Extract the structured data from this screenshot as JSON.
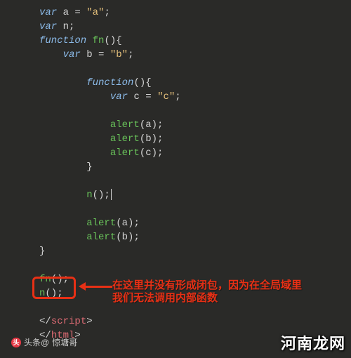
{
  "code": {
    "l1a": "var",
    "l1b": " a = ",
    "l1c": "\"a\"",
    "l1d": ";",
    "l2a": "var",
    "l2b": " n;",
    "l3a": "function",
    "l3b": " ",
    "l3c": "fn",
    "l3d": "(){",
    "l4a": "var",
    "l4b": " b = ",
    "l4c": "\"b\"",
    "l4d": ";",
    "l5a": "function",
    "l5b": "(){",
    "l6a": "var",
    "l6b": " c = ",
    "l6c": "\"c\"",
    "l6d": ";",
    "l7a": "alert",
    "l7b": "(a);",
    "l8a": "alert",
    "l8b": "(b);",
    "l9a": "alert",
    "l9b": "(c);",
    "l10": "}",
    "l11a": "n",
    "l11b": "();",
    "l12a": "alert",
    "l12b": "(a);",
    "l13a": "alert",
    "l13b": "(b);",
    "l14": "}",
    "l15a": "fn",
    "l15b": "();",
    "l16a": "n",
    "l16b": "();",
    "l17a": "<",
    "l17b": "/",
    "l17c": "script",
    "l17d": ">",
    "l18a": "<",
    "l18b": "/",
    "l18c": "html",
    "l18d": ">"
  },
  "callout": {
    "line1": "在这里并没有形成闭包，因为在全局域里",
    "line2": "我们无法调用内部函数"
  },
  "watermarks": {
    "left_prefix": "头条@",
    "left_name": "惊塘哥",
    "right": "河南龙网"
  }
}
